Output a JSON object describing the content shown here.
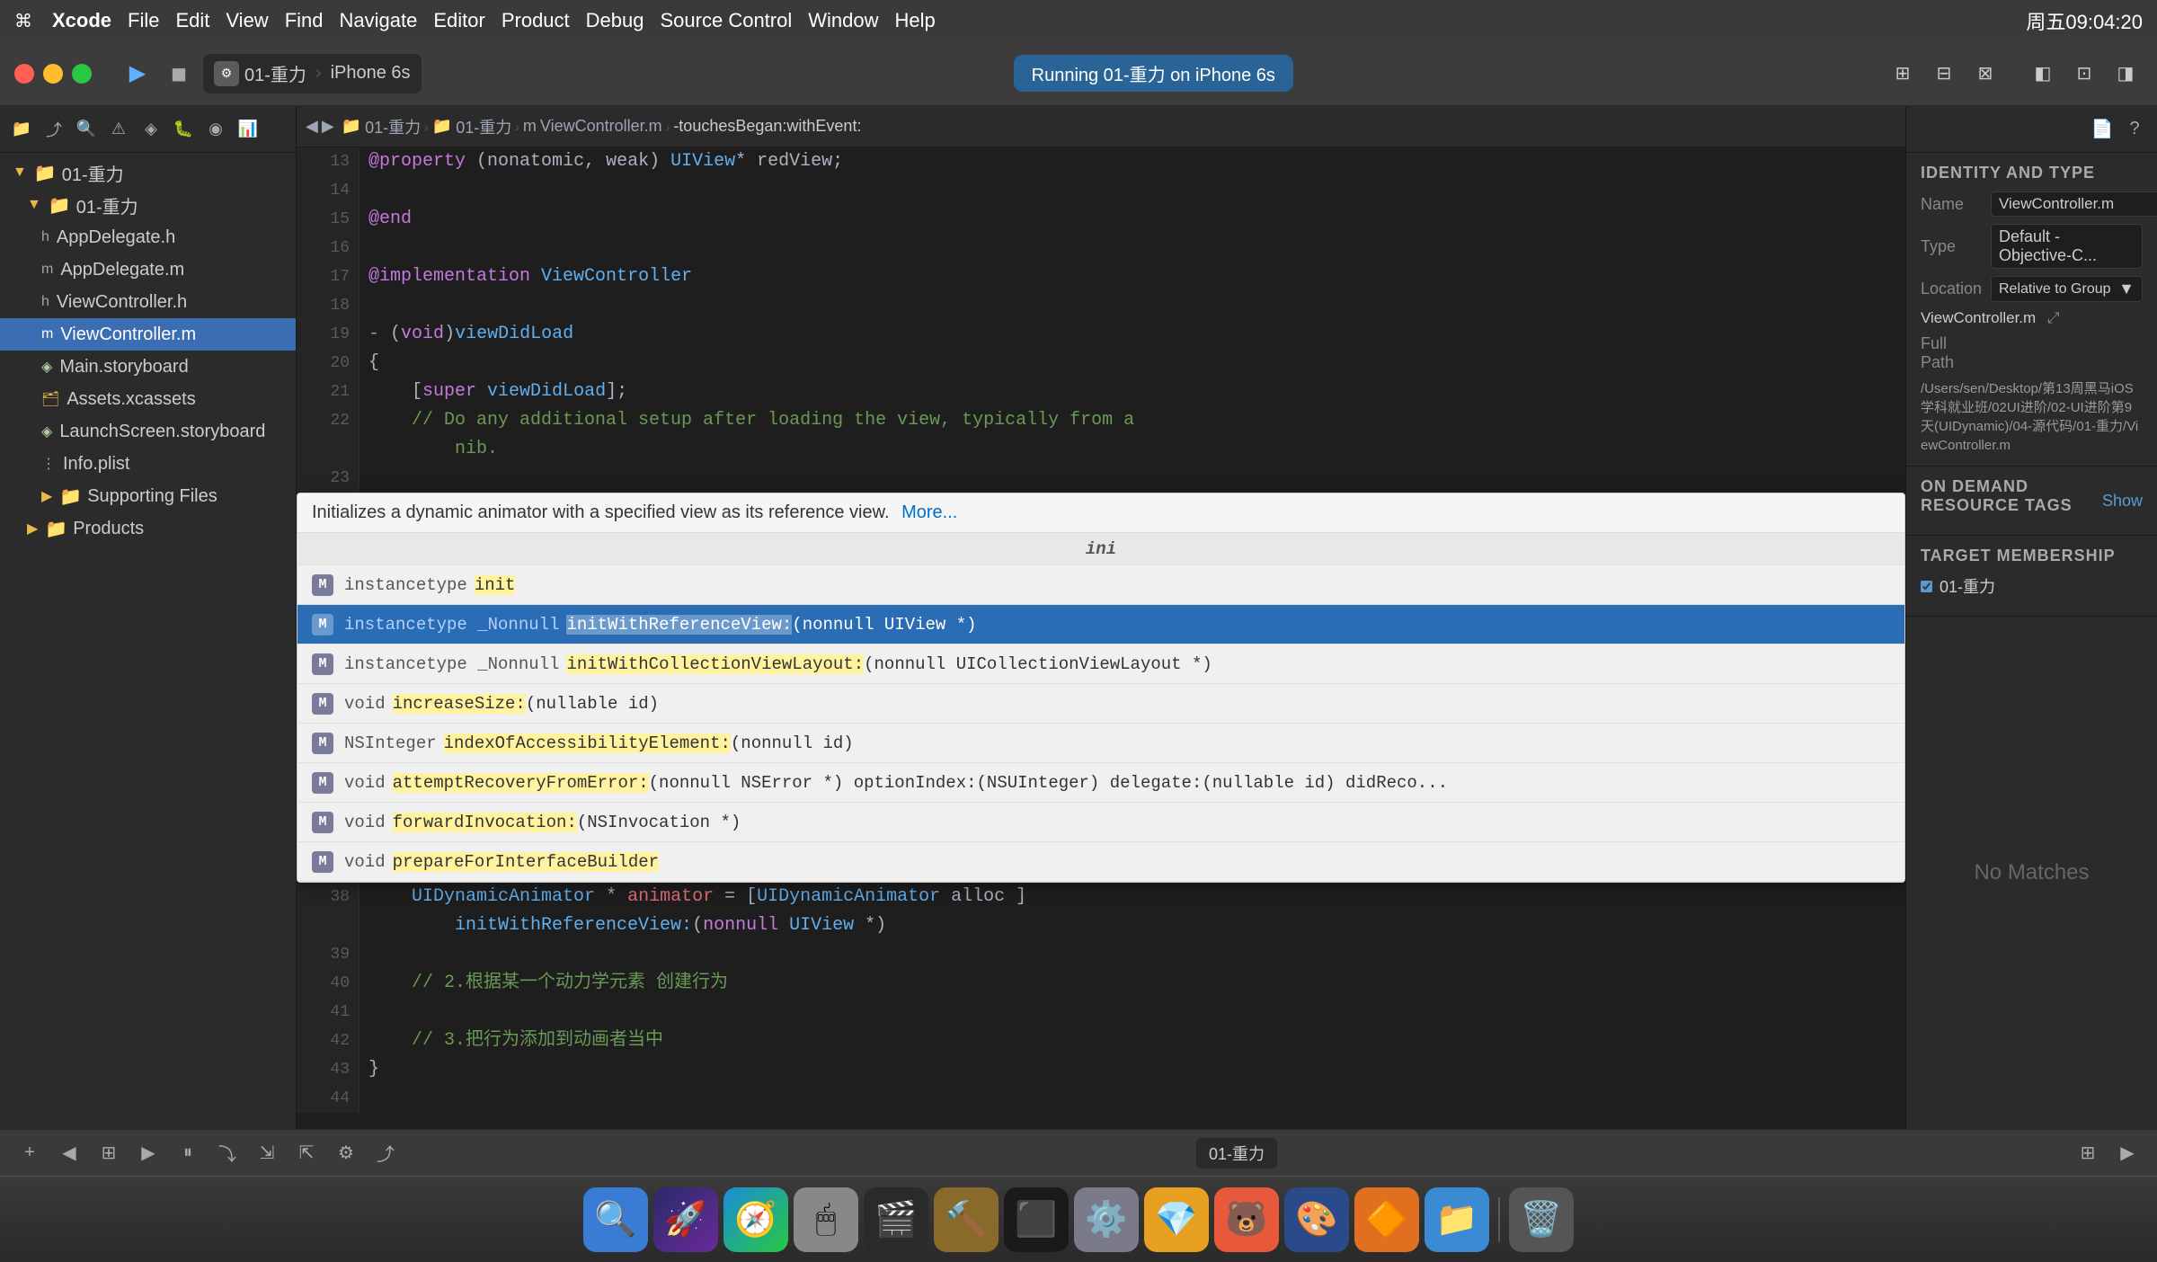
{
  "menubar": {
    "apple": "⌘",
    "items": [
      "Xcode",
      "File",
      "Edit",
      "View",
      "Find",
      "Navigate",
      "Editor",
      "Product",
      "Debug",
      "Source Control",
      "Window",
      "Help"
    ],
    "right": {
      "time": "周五09:04:20",
      "icons": [
        "battery",
        "wifi",
        "bluetooth",
        "volume",
        "search"
      ]
    }
  },
  "toolbar": {
    "scheme": "01-重力",
    "device": "iPhone 6s",
    "status": "Running 01-重力 on iPhone 6s",
    "run_label": "▶",
    "stop_label": "◼"
  },
  "sidebar": {
    "tree": [
      {
        "id": "root",
        "label": "01-重力",
        "indent": 0,
        "type": "group",
        "expanded": true
      },
      {
        "id": "01li",
        "label": "01-重力",
        "indent": 1,
        "type": "group",
        "expanded": true
      },
      {
        "id": "appdelegate_h",
        "label": "AppDelegate.h",
        "indent": 2,
        "type": "file"
      },
      {
        "id": "appdelegate_m",
        "label": "AppDelegate.m",
        "indent": 2,
        "type": "file"
      },
      {
        "id": "viewcontroller_h",
        "label": "ViewController.h",
        "indent": 2,
        "type": "file"
      },
      {
        "id": "viewcontroller_m",
        "label": "ViewController.m",
        "indent": 2,
        "type": "file_selected"
      },
      {
        "id": "main_storyboard",
        "label": "Main.storyboard",
        "indent": 2,
        "type": "file"
      },
      {
        "id": "assets",
        "label": "Assets.xcassets",
        "indent": 2,
        "type": "file"
      },
      {
        "id": "launch",
        "label": "LaunchScreen.storyboard",
        "indent": 2,
        "type": "file"
      },
      {
        "id": "info",
        "label": "Info.plist",
        "indent": 2,
        "type": "file"
      },
      {
        "id": "supporting",
        "label": "Supporting Files",
        "indent": 2,
        "type": "group"
      },
      {
        "id": "products",
        "label": "Products",
        "indent": 1,
        "type": "group"
      }
    ]
  },
  "breadcrumb": {
    "items": [
      "01-重力",
      "01-重力",
      "ViewController.m",
      "-touchesBegan:withEvent:"
    ]
  },
  "code": {
    "top_lines": [
      {
        "num": 13,
        "text": "@property (nonatomic, weak) UIView* redView;"
      },
      {
        "num": 14,
        "text": ""
      },
      {
        "num": 15,
        "text": "@end"
      },
      {
        "num": 16,
        "text": ""
      },
      {
        "num": 17,
        "text": "@implementation ViewController"
      },
      {
        "num": 18,
        "text": ""
      },
      {
        "num": 19,
        "text": "- (void)viewDidLoad"
      },
      {
        "num": 20,
        "text": "{"
      },
      {
        "num": 21,
        "text": "    [super viewDidLoad];"
      },
      {
        "num": 22,
        "text": "    // Do any additional setup after loading the view, typically from a"
      },
      {
        "num": 22.1,
        "text": "        nib."
      },
      {
        "num": 23,
        "text": ""
      }
    ],
    "autocomplete_header": "Initializes a dynamic animator with a specified view as its reference view.",
    "autocomplete_more": "More...",
    "autocomplete_search": "ini",
    "autocomplete_items": [
      {
        "badge": "M",
        "type": "instancetype",
        "highlight": "init",
        "rest": "",
        "id": "init"
      },
      {
        "badge": "M",
        "type": "instancetype _Nonnull",
        "highlight": "initWithReferenceView:",
        "rest": "(nonnull UIView *)",
        "id": "initWithReferenceView",
        "selected": true
      },
      {
        "badge": "M",
        "type": "instancetype _Nonnull",
        "highlight": "initWithCollectionViewLayout:",
        "rest": "(nonnull UICollectionViewLayout *)",
        "id": "initWithCollectionViewLayout"
      },
      {
        "badge": "M",
        "type": "void",
        "highlight": "increaseSize:",
        "rest": "(nullable id)",
        "id": "increaseSize"
      },
      {
        "badge": "M",
        "type": "NSInteger",
        "highlight": "indexOfAccessibilityElement:",
        "rest": "(nonnull id)",
        "id": "indexOfAccessibilityElement"
      },
      {
        "badge": "M",
        "type": "void",
        "highlight": "attemptRecoveryFromError:",
        "rest": "(nonnull NSError *) optionIndex:(NSUInteger) delegate:(nullable id) didReco...",
        "id": "attemptRecovery"
      },
      {
        "badge": "M",
        "type": "void",
        "highlight": "forwardInvocation:",
        "rest": "(NSInvocation *)",
        "id": "forwardInvocation"
      },
      {
        "badge": "M",
        "type": "void",
        "highlight": "prepareForInterfaceBuilder",
        "rest": "",
        "id": "prepareForInterfaceBuilder"
      }
    ],
    "bottom_lines": [
      {
        "num": 38,
        "text": "    UIDynamicAnimator * animator = [UIDynamicAnimator alloc ]"
      },
      {
        "num": 38.1,
        "text": "        initWithReferenceView:(nonnull UIView *)"
      },
      {
        "num": 39,
        "text": ""
      },
      {
        "num": 40,
        "text": "    // 2.根据某一个动力学元素 创建行为"
      },
      {
        "num": 41,
        "text": ""
      },
      {
        "num": 42,
        "text": "    // 3.把行为添加到动画者当中"
      },
      {
        "num": 43,
        "text": "}"
      },
      {
        "num": 44,
        "text": ""
      }
    ]
  },
  "inspector": {
    "identity_and_type": {
      "title": "Identity and Type",
      "name_label": "Name",
      "name_value": "ViewController.m",
      "type_label": "Type",
      "type_value": "Default - Objective-C...",
      "location_label": "Location",
      "location_value": "Relative to Group",
      "full_path_label": "Full Path",
      "full_path_value": "/Users/sen/Desktop/第13周黑马iOS学科就业班/02UI进阶/02-UI进阶第9天(UIDynamic)/04-源代码/01-重力/ViewController.m"
    },
    "on_demand_resource_tags": {
      "title": "On Demand Resource Tags",
      "show_label": "Show"
    },
    "target_membership": {
      "title": "Target Membership",
      "item": "01-重力"
    }
  },
  "no_matches": "No Matches",
  "bottom_bar": {
    "scheme_label": "01-重力"
  },
  "dock": {
    "items": [
      {
        "name": "finder",
        "emoji": "🔍",
        "bg": "#3a7bd5"
      },
      {
        "name": "launchpad",
        "emoji": "🚀",
        "bg": "#2a2a6a"
      },
      {
        "name": "safari",
        "emoji": "🧭",
        "bg": "#1a8cd8"
      },
      {
        "name": "system-preferences",
        "emoji": "⚙️",
        "bg": "#8a8a8a"
      },
      {
        "name": "quicktime",
        "emoji": "🎬",
        "bg": "#2a2a2a"
      },
      {
        "name": "terminal",
        "emoji": "⬛",
        "bg": "#1a1a1a"
      },
      {
        "name": "spotlight",
        "emoji": "🔍",
        "bg": "#555"
      },
      {
        "name": "sketch",
        "emoji": "💎",
        "bg": "#e8a020"
      },
      {
        "name": "bear",
        "emoji": "🐻",
        "bg": "#e8583a"
      },
      {
        "name": "medibang",
        "emoji": "🎨",
        "bg": "#2a4a8a"
      },
      {
        "name": "finder2",
        "emoji": "📁",
        "bg": "#3a8ad4"
      },
      {
        "name": "vlc",
        "emoji": "🔶",
        "bg": "#e8a020"
      },
      {
        "name": "trash",
        "emoji": "🗑️",
        "bg": "#555"
      }
    ]
  }
}
